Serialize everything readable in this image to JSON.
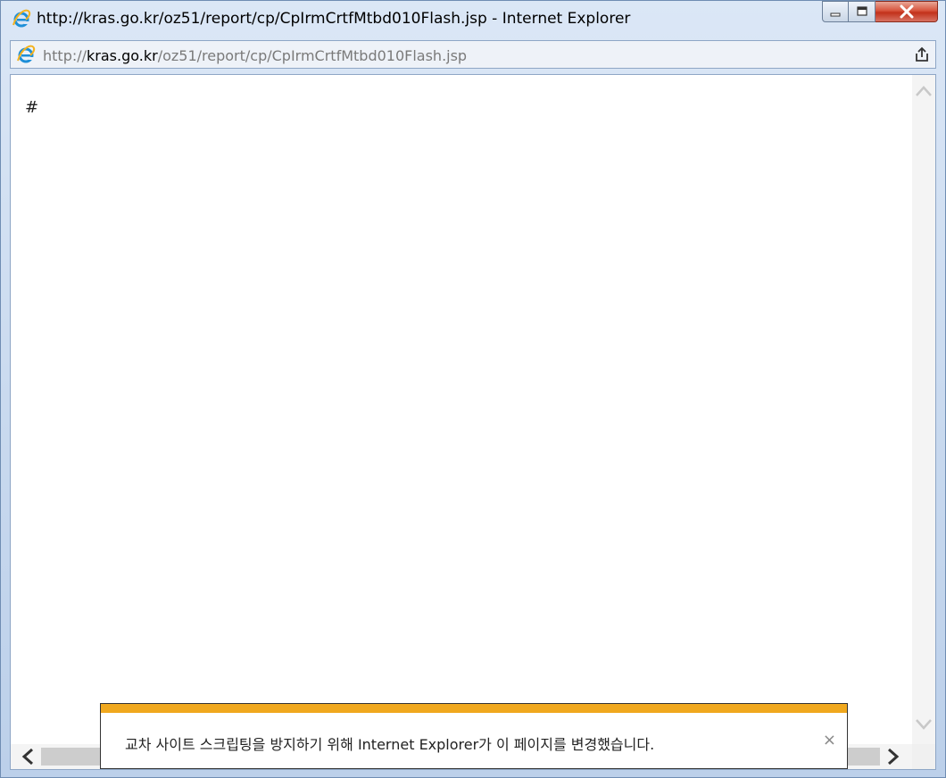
{
  "window": {
    "title": "http://kras.go.kr/oz51/report/cp/CpIrmCrtfMtbd010Flash.jsp - Internet Explorer"
  },
  "address_bar": {
    "prefix": "http://",
    "host": "kras.go.kr",
    "path": "/oz51/report/cp/CpIrmCrtfMtbd010Flash.jsp"
  },
  "page": {
    "body_text": "#"
  },
  "notification": {
    "message": "교차 사이트 스크립팅을 방지하기 위해 Internet Explorer가 이 페이지를 변경했습니다.",
    "close_label": "×"
  },
  "colors": {
    "notification_accent": "#f0a81e",
    "close_button": "#c2311a",
    "ie_logo": "#1e8fd8"
  },
  "icons": {
    "title": "ie-logo-icon",
    "address": "ie-logo-icon",
    "share": "share-icon",
    "minimize": "minimize-icon",
    "maximize": "maximize-icon",
    "close": "close-icon"
  }
}
